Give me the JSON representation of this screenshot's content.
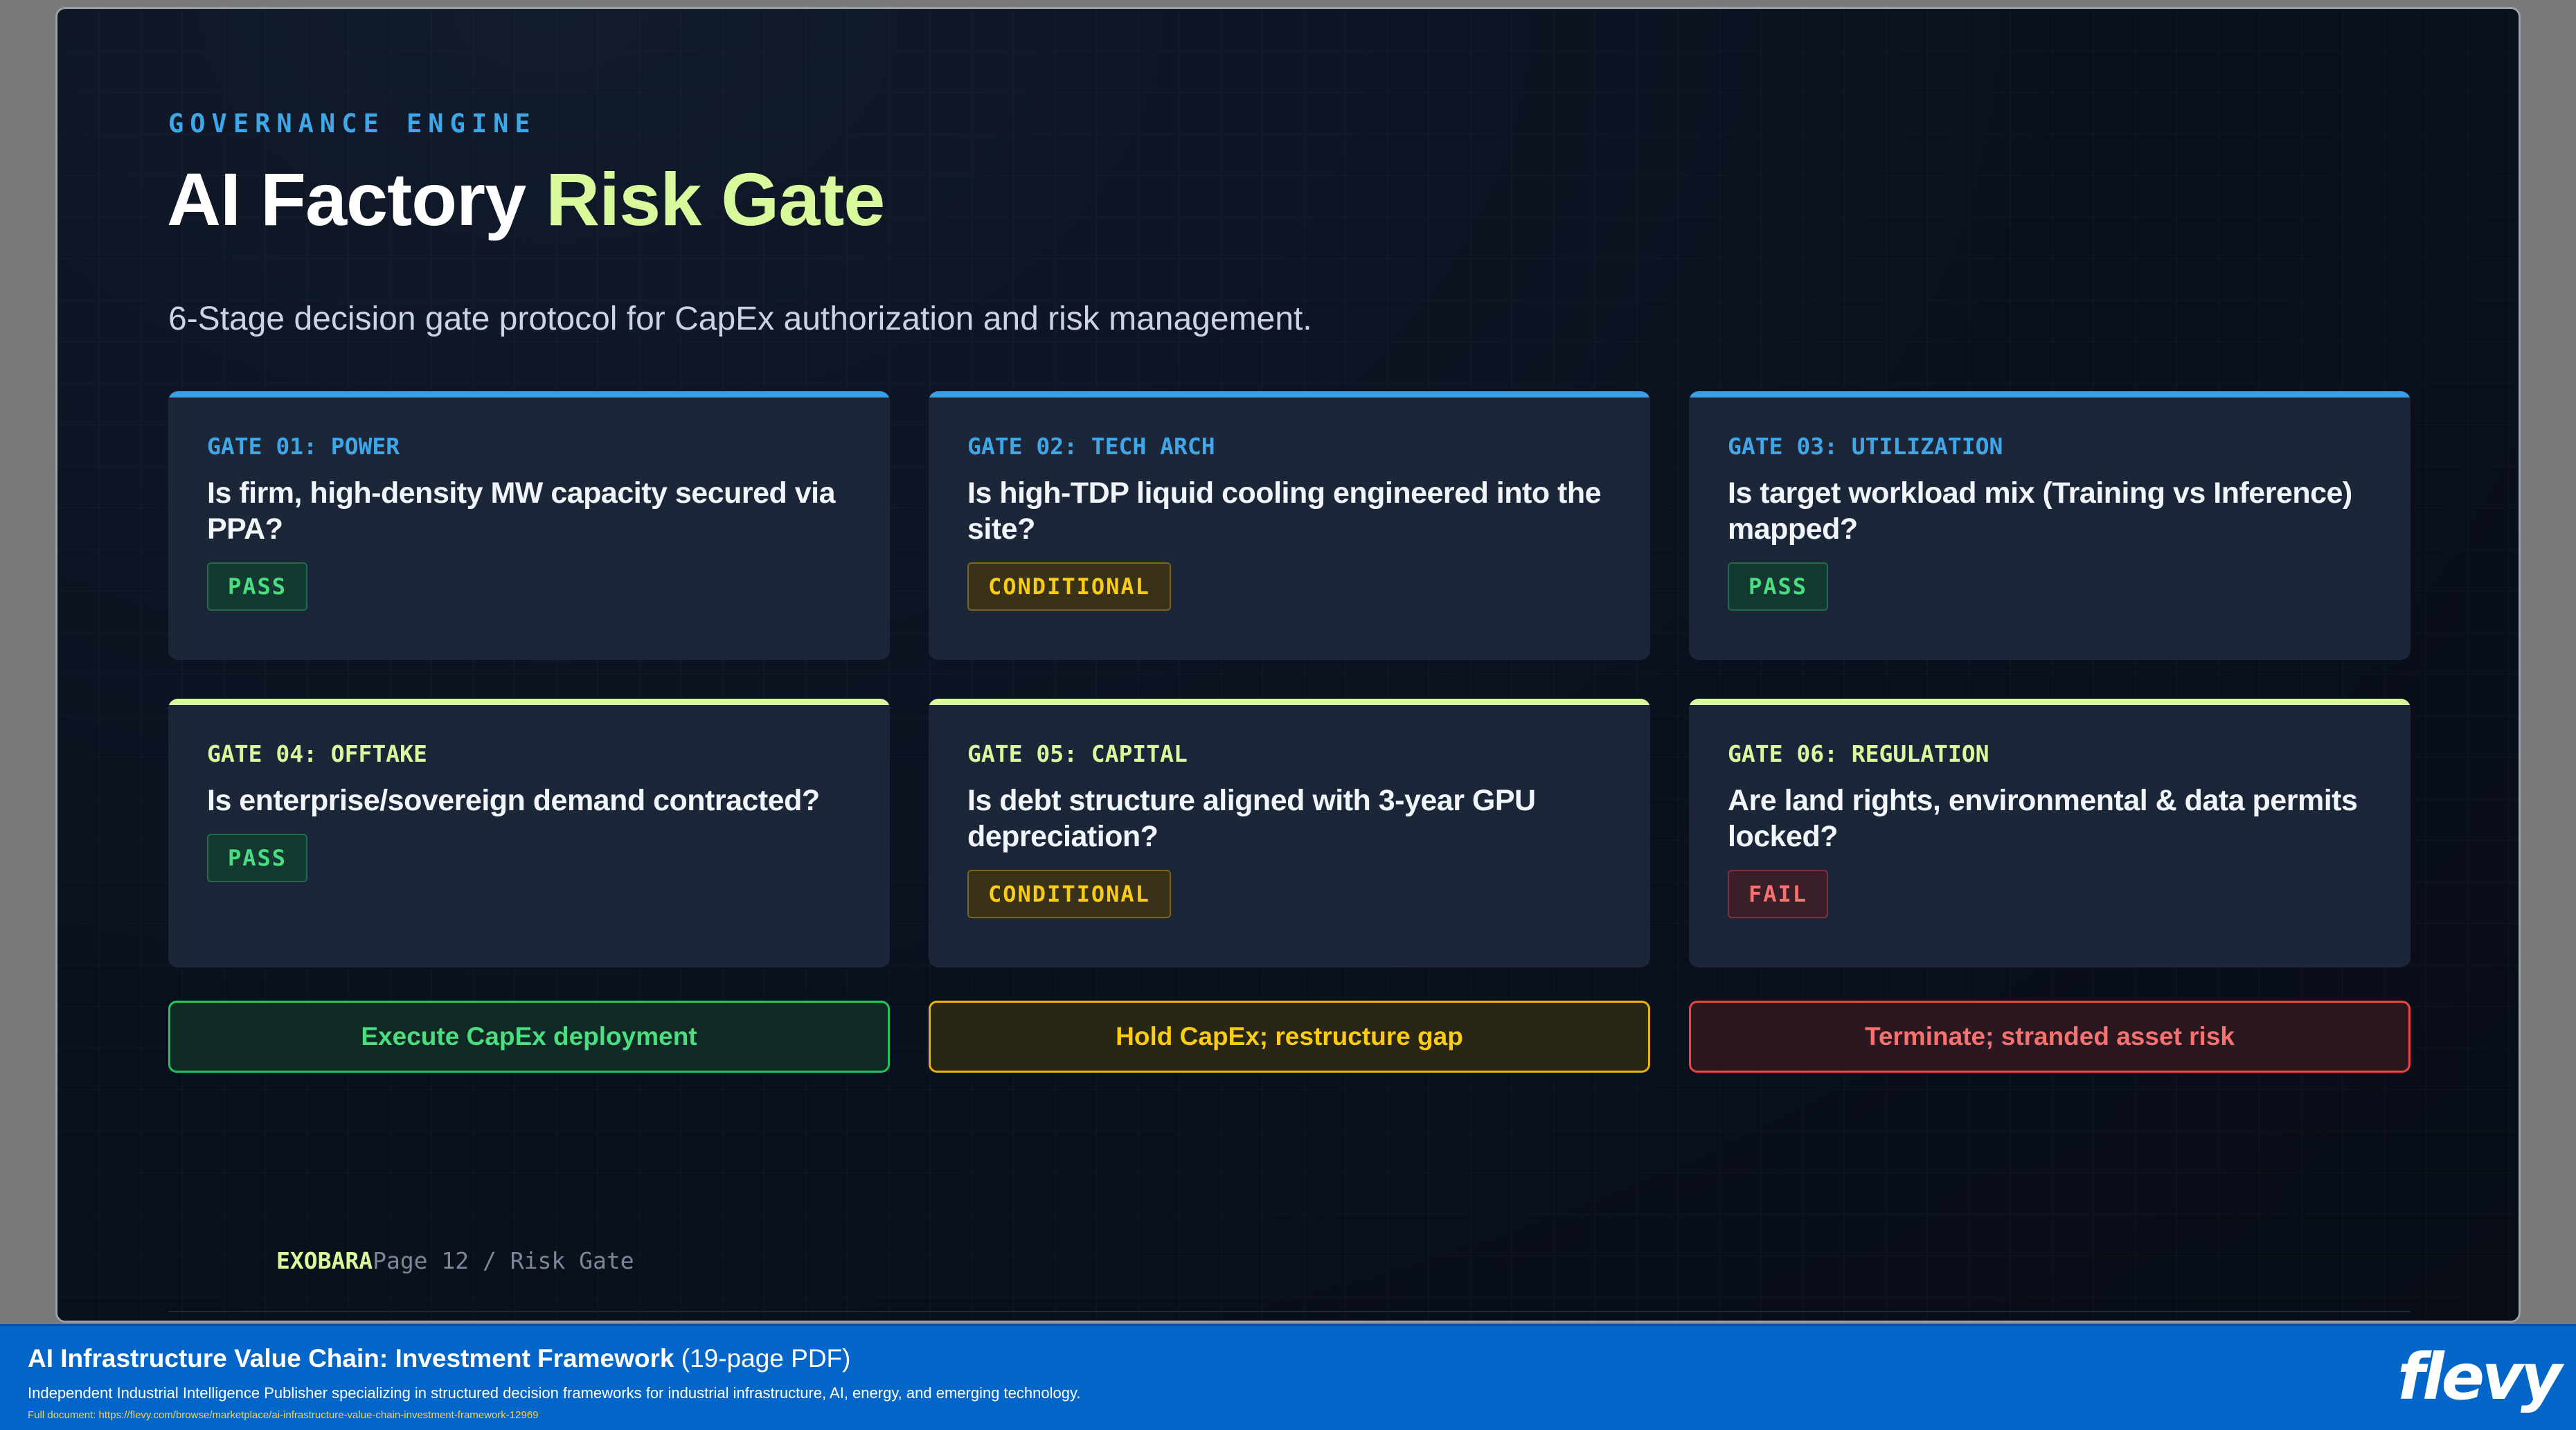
{
  "slide": {
    "eyebrow": "GOVERNANCE ENGINE",
    "title_main": "AI Factory ",
    "title_accent": "Risk Gate",
    "subtitle": "6-Stage decision gate protocol for CapEx authorization and risk management.",
    "gates": [
      {
        "label": "GATE 01: POWER",
        "question": "Is firm, high-density MW capacity secured via PPA?",
        "status": "PASS",
        "status_type": "pass"
      },
      {
        "label": "GATE 02: TECH ARCH",
        "question": "Is high-TDP liquid cooling engineered into the site?",
        "status": "CONDITIONAL",
        "status_type": "conditional"
      },
      {
        "label": "GATE 03: UTILIZATION",
        "question": "Is target workload mix (Training vs Inference) mapped?",
        "status": "PASS",
        "status_type": "pass"
      },
      {
        "label": "GATE 04: OFFTAKE",
        "question": "Is enterprise/sovereign demand contracted?",
        "status": "PASS",
        "status_type": "pass"
      },
      {
        "label": "GATE 05: CAPITAL",
        "question": "Is debt structure aligned with 3-year GPU depreciation?",
        "status": "CONDITIONAL",
        "status_type": "conditional"
      },
      {
        "label": "GATE 06: REGULATION",
        "question": "Are land rights, environmental & data permits locked?",
        "status": "FAIL",
        "status_type": "fail"
      }
    ],
    "outcomes": [
      {
        "label": "Execute CapEx deployment",
        "type": "go"
      },
      {
        "label": "Hold CapEx; restructure gap",
        "type": "hold"
      },
      {
        "label": "Terminate; stranded asset risk",
        "type": "stop"
      }
    ],
    "footer_brand": "EXOBARA",
    "footer_page": "Page 12 / Risk Gate"
  },
  "banner": {
    "title": "AI Infrastructure Value Chain: Investment Framework",
    "pages": " (19-page PDF)",
    "description": "Independent Industrial Intelligence Publisher specializing in structured decision frameworks for industrial infrastructure, AI, energy, and emerging technology.",
    "url": "Full document: https://flevy.com/browse/marketplace/ai-infrastructure-value-chain-investment-framework-12969",
    "logo": "flevy"
  },
  "colors": {
    "accent_blue": "#3fa7e8",
    "accent_lime": "#d9f99d",
    "pass": "#4ade80",
    "conditional": "#facc15",
    "fail": "#f87171",
    "banner": "#0466c8"
  }
}
